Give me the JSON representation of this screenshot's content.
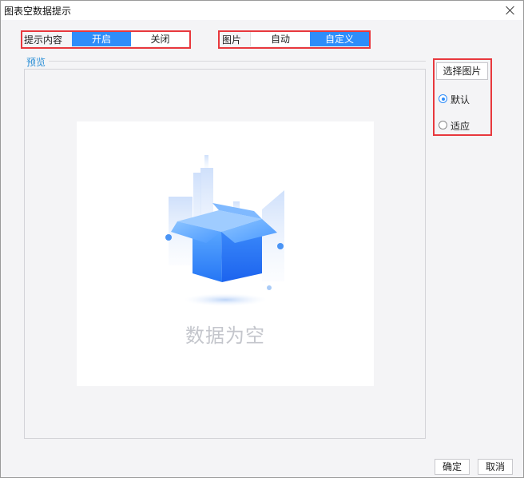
{
  "window": {
    "title": "图表空数据提示"
  },
  "prompt_content": {
    "label": "提示内容",
    "options": [
      {
        "label": "开启",
        "selected": true
      },
      {
        "label": "关闭",
        "selected": false
      }
    ]
  },
  "picture": {
    "label": "图片",
    "options": [
      {
        "label": "自动",
        "selected": false
      },
      {
        "label": "自定义",
        "selected": true
      }
    ]
  },
  "preview": {
    "legend": "预览",
    "empty_text": "数据为空"
  },
  "side_panel": {
    "choose_image_label": "选择图片",
    "radios": [
      {
        "label": "默认",
        "checked": true
      },
      {
        "label": "适应",
        "checked": false
      }
    ]
  },
  "footer": {
    "ok_label": "确定",
    "cancel_label": "取消"
  },
  "colors": {
    "accent": "#2e8dfa",
    "highlight": "#e8383d",
    "legend": "#2b8fd6"
  }
}
